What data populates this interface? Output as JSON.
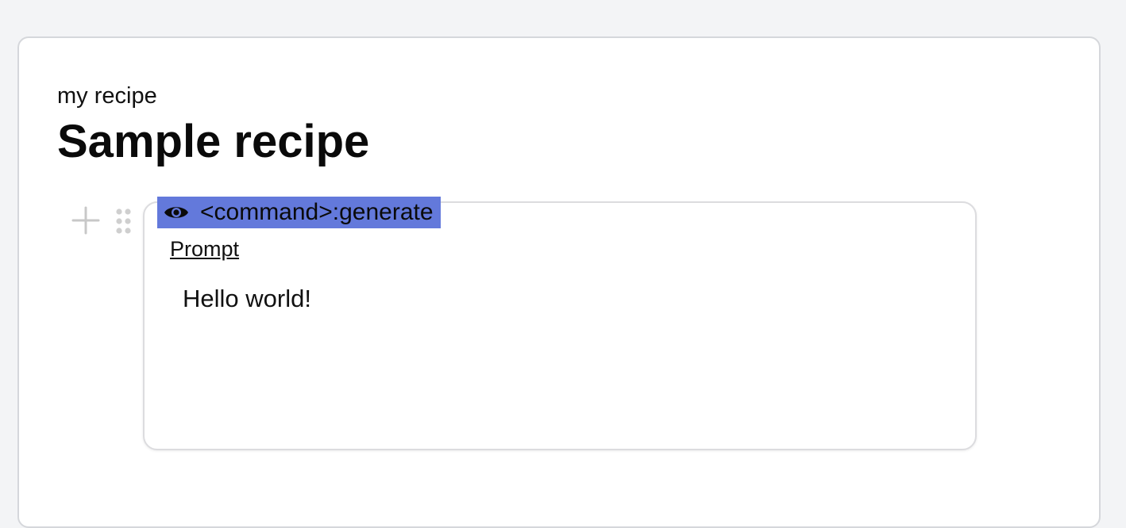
{
  "recipe": {
    "subtitle": "my recipe",
    "title": "Sample recipe"
  },
  "block": {
    "command_label": "<command>:generate",
    "command_icon": "eye-icon",
    "prompt_link_label": "Prompt",
    "prompt_text": "Hello world!"
  },
  "controls": {
    "add_icon": "plus-icon",
    "drag_icon": "drag-handle-icon"
  },
  "colors": {
    "command_tag_bg": "#6379db",
    "page_bg": "#f3f4f6",
    "card_bg": "#ffffff",
    "control_gray": "#c8c8c8"
  }
}
